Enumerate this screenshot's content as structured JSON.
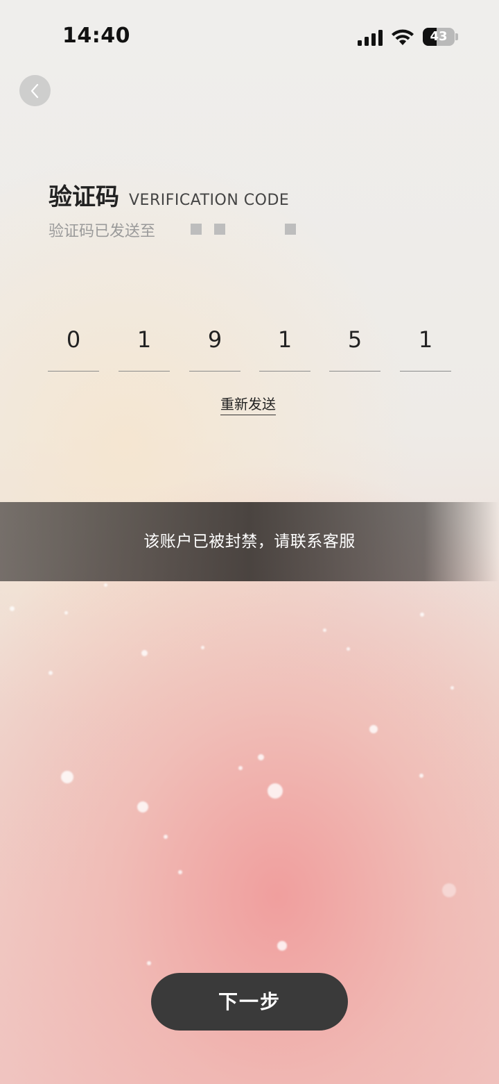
{
  "status_bar": {
    "time": "14:40",
    "battery": "43",
    "battery_level": 0.43
  },
  "header": {
    "back_icon": "chevron-left-icon"
  },
  "title": {
    "cn": "验证码",
    "en": "VERIFICATION CODE"
  },
  "subtitle": "验证码已发送至",
  "code": {
    "digits": [
      "0",
      "1",
      "9",
      "1",
      "5",
      "1"
    ]
  },
  "resend": {
    "label": "重新发送"
  },
  "toast": {
    "message": "该账户已被封禁，请联系客服"
  },
  "next_button": {
    "label": "下一步"
  },
  "colors": {
    "button": "#3a3a3a",
    "accent_pink": "#f0a0a0",
    "toast": "#3c3734"
  }
}
